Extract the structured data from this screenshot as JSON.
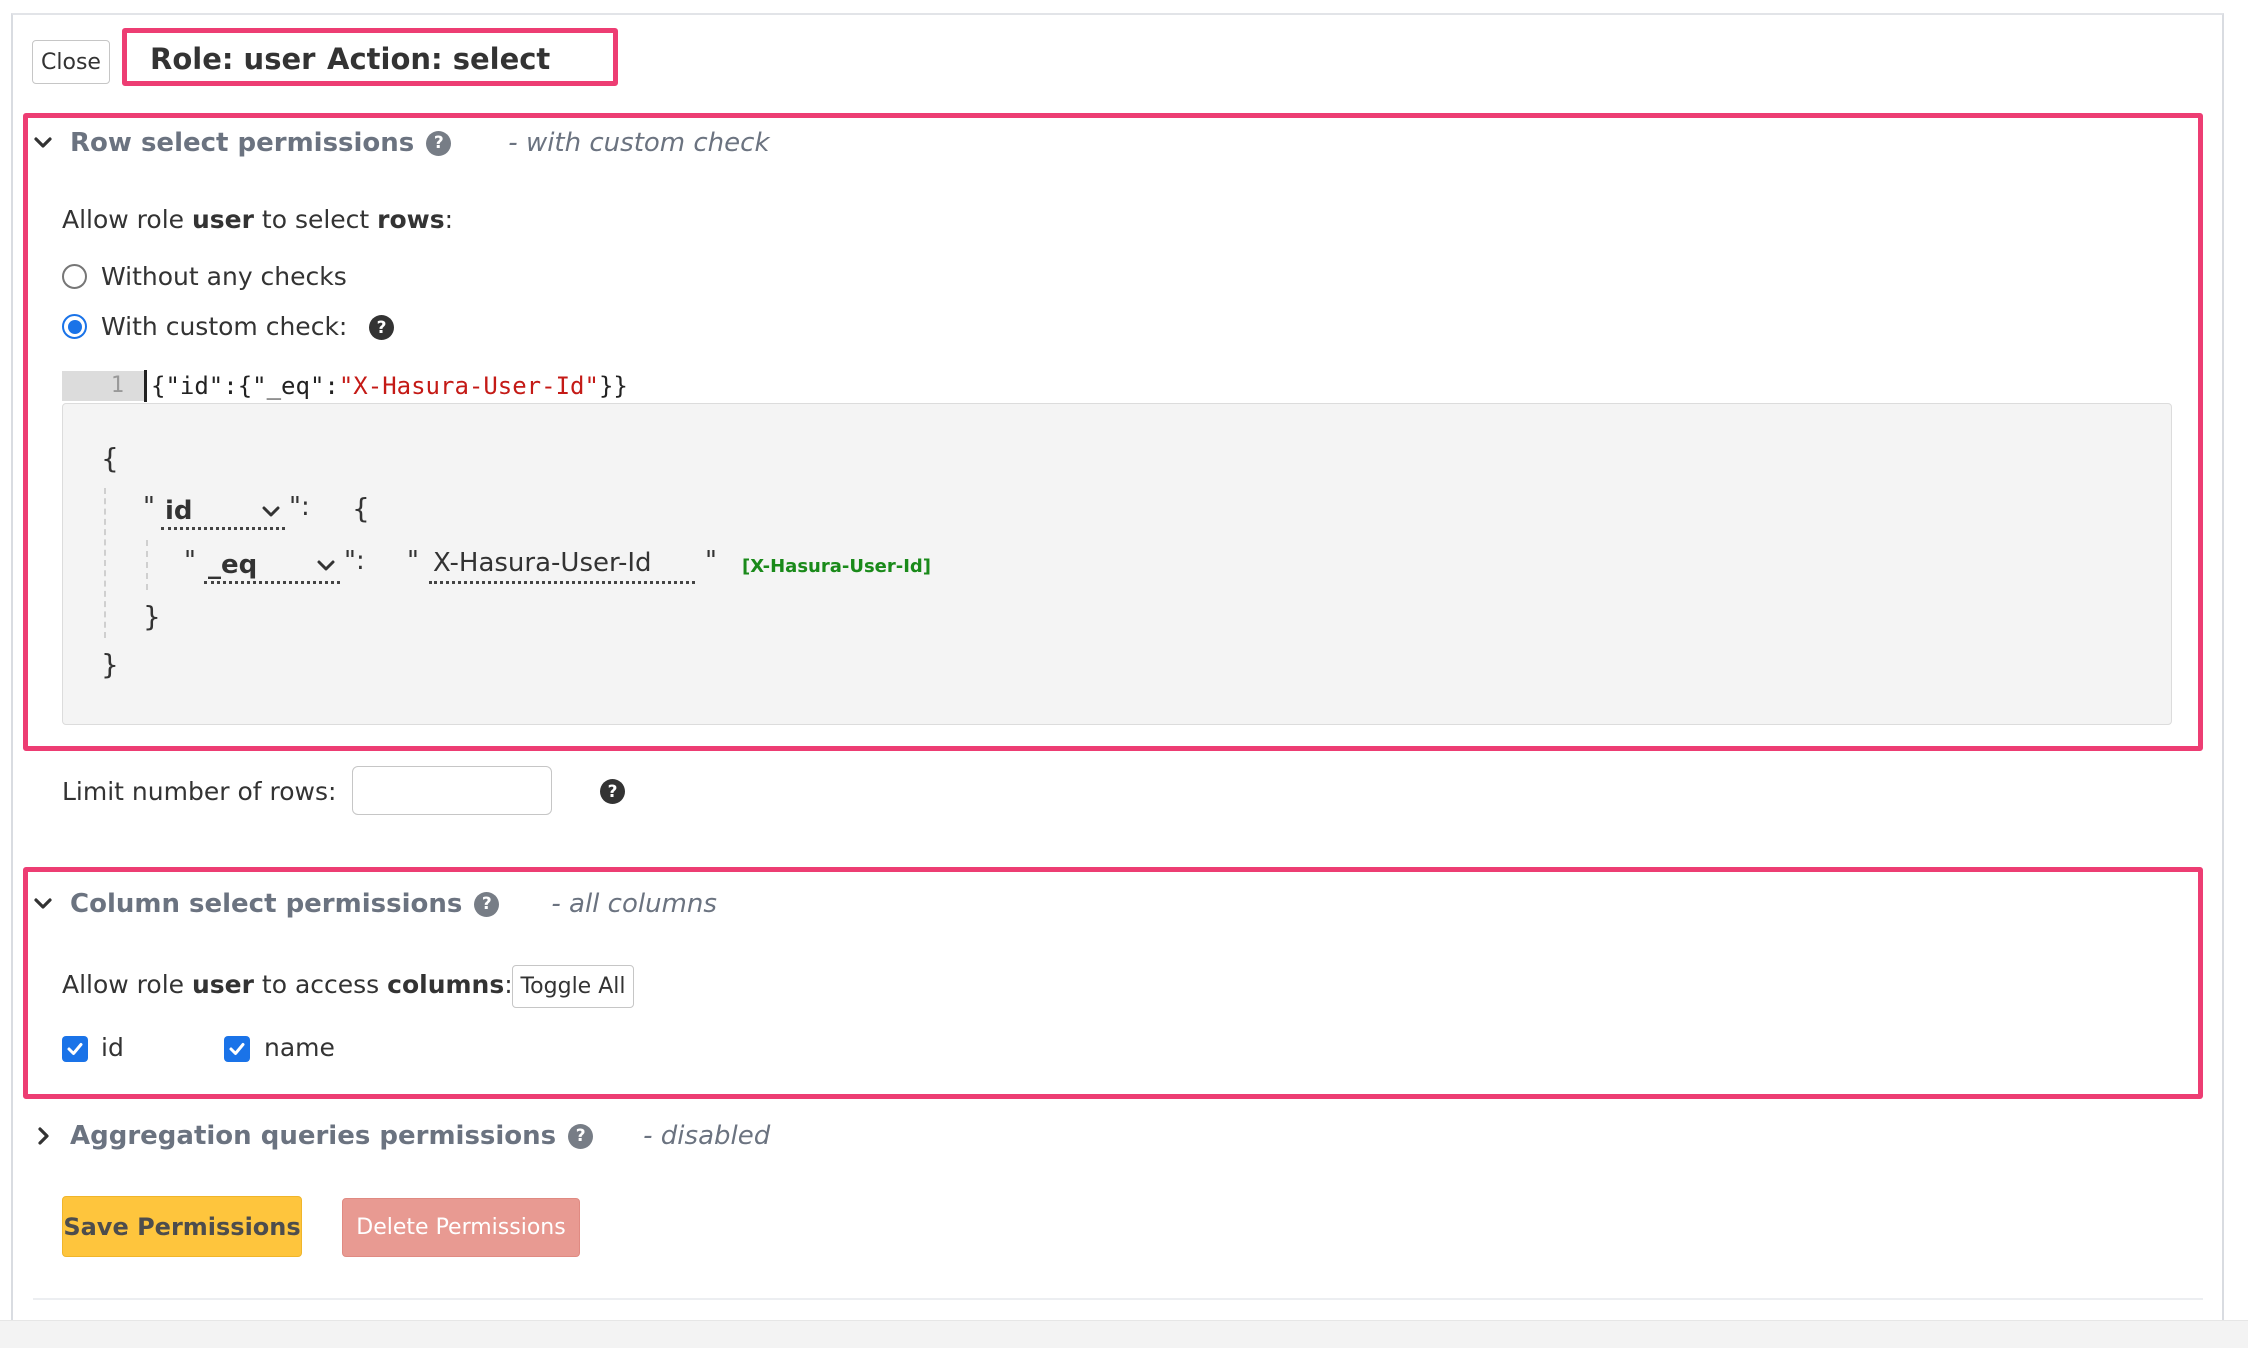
{
  "header": {
    "close_label": "Close",
    "role_text": "Role: user",
    "action_text": "Action: select"
  },
  "row_section": {
    "title": "Row select permissions",
    "status": "- with custom check",
    "allow_prefix": "Allow role ",
    "role": "user",
    "allow_middle": " to select ",
    "object": "rows",
    "allow_suffix": ":",
    "option_none": "Without any checks",
    "option_custom": "With custom check:",
    "selected_option": "With custom check:"
  },
  "editor": {
    "line_number": "1",
    "code_prefix": "{\"id\":{\"_eq\":",
    "code_string": "\"X-Hasura-User-Id\"",
    "code_suffix": "}}"
  },
  "builder": {
    "open_brace": "{",
    "close_brace": "}",
    "quote": "\"",
    "colon": "\":",
    "column": "id",
    "operator": "_eq",
    "value": "X-Hasura-User-Id",
    "hint": "[X-Hasura-User-Id]"
  },
  "limit": {
    "label": "Limit number of rows:",
    "value": ""
  },
  "column_section": {
    "title": "Column select permissions",
    "status": "- all columns",
    "allow_prefix": "Allow role ",
    "role": "user",
    "allow_middle": " to access ",
    "object": "columns",
    "allow_suffix": ":",
    "toggle_label": "Toggle All",
    "columns": [
      {
        "name": "id",
        "checked": true
      },
      {
        "name": "name",
        "checked": true
      }
    ]
  },
  "aggregation_section": {
    "title": "Aggregation queries permissions",
    "status": "- disabled"
  },
  "actions": {
    "save_label": "Save Permissions",
    "delete_label": "Delete Permissions"
  },
  "colors": {
    "highlight": "#ed3d73",
    "accent_blue": "#1a73e8",
    "save_yellow": "#fec53d",
    "delete_red": "#e89a92",
    "hint_green": "#1a8a1a",
    "string_red": "#c41a16"
  },
  "icons": {
    "help": "question-circle-icon",
    "expanded": "chevron-down-icon",
    "collapsed": "chevron-right-icon",
    "dropdown": "chevron-down-icon",
    "checkbox": "check-icon"
  }
}
